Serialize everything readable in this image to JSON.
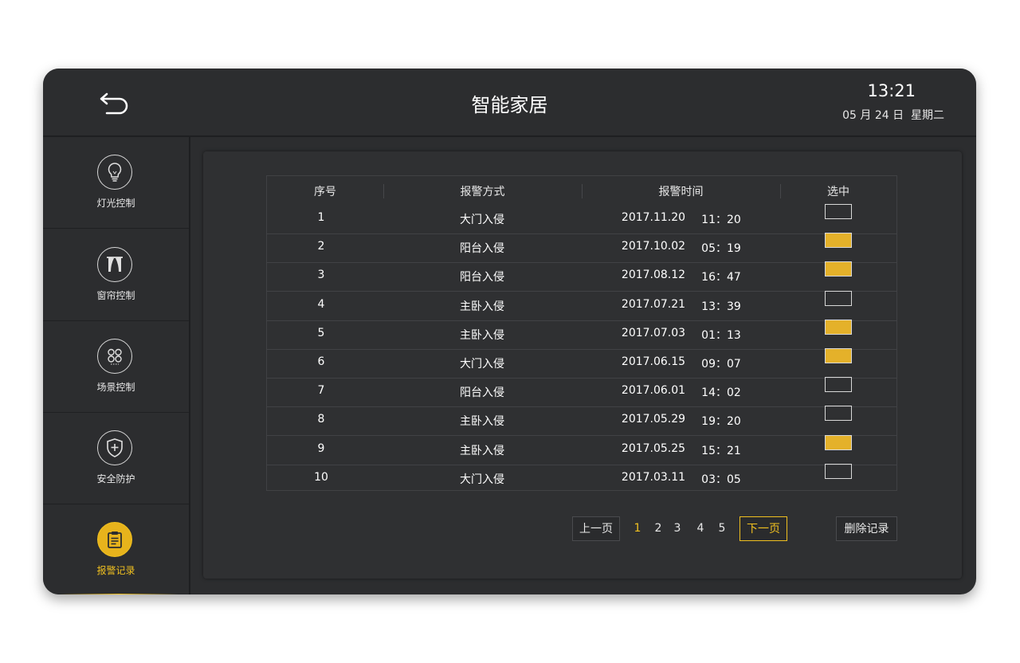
{
  "header": {
    "title": "智能家居",
    "time": "13:21",
    "date": "05 月 24 日",
    "weekday": "星期二"
  },
  "sidebar": {
    "items": [
      {
        "label": "灯光控制",
        "icon": "lightbulb-icon"
      },
      {
        "label": "窗帘控制",
        "icon": "curtain-icon"
      },
      {
        "label": "场景控制",
        "icon": "scene-icon"
      },
      {
        "label": "安全防护",
        "icon": "shield-icon"
      },
      {
        "label": "报警记录",
        "icon": "clipboard-icon",
        "active": true
      }
    ]
  },
  "table": {
    "columns": [
      "序号",
      "报警方式",
      "报警时间",
      "选中"
    ],
    "rows": [
      {
        "no": "1",
        "type": "大门入侵",
        "date": "2017.11.20",
        "time": "11：20",
        "selected": false
      },
      {
        "no": "2",
        "type": "阳台入侵",
        "date": "2017.10.02",
        "time": "05：19",
        "selected": true
      },
      {
        "no": "3",
        "type": "阳台入侵",
        "date": "2017.08.12",
        "time": "16：47",
        "selected": true
      },
      {
        "no": "4",
        "type": "主卧入侵",
        "date": "2017.07.21",
        "time": "13：39",
        "selected": false
      },
      {
        "no": "5",
        "type": "主卧入侵",
        "date": "2017.07.03",
        "time": "01：13",
        "selected": true
      },
      {
        "no": "6",
        "type": "大门入侵",
        "date": "2017.06.15",
        "time": "09：07",
        "selected": true
      },
      {
        "no": "7",
        "type": "阳台入侵",
        "date": "2017.06.01",
        "time": "14：02",
        "selected": false
      },
      {
        "no": "8",
        "type": "主卧入侵",
        "date": "2017.05.29",
        "time": "19：20",
        "selected": false
      },
      {
        "no": "9",
        "type": "主卧入侵",
        "date": "2017.05.25",
        "time": "15：21",
        "selected": true
      },
      {
        "no": "10",
        "type": "大门入侵",
        "date": "2017.03.11",
        "time": "03：05",
        "selected": false
      }
    ]
  },
  "pagination": {
    "prev_label": "上一页",
    "next_label": "下一页",
    "pages": [
      "1",
      "2",
      "3",
      "4",
      "5"
    ],
    "current": "1",
    "delete_label": "删除记录"
  },
  "colors": {
    "accent": "#f0c020",
    "checked": "#e4b12a",
    "background": "#2c2d2f",
    "panel": "#2f3032"
  }
}
